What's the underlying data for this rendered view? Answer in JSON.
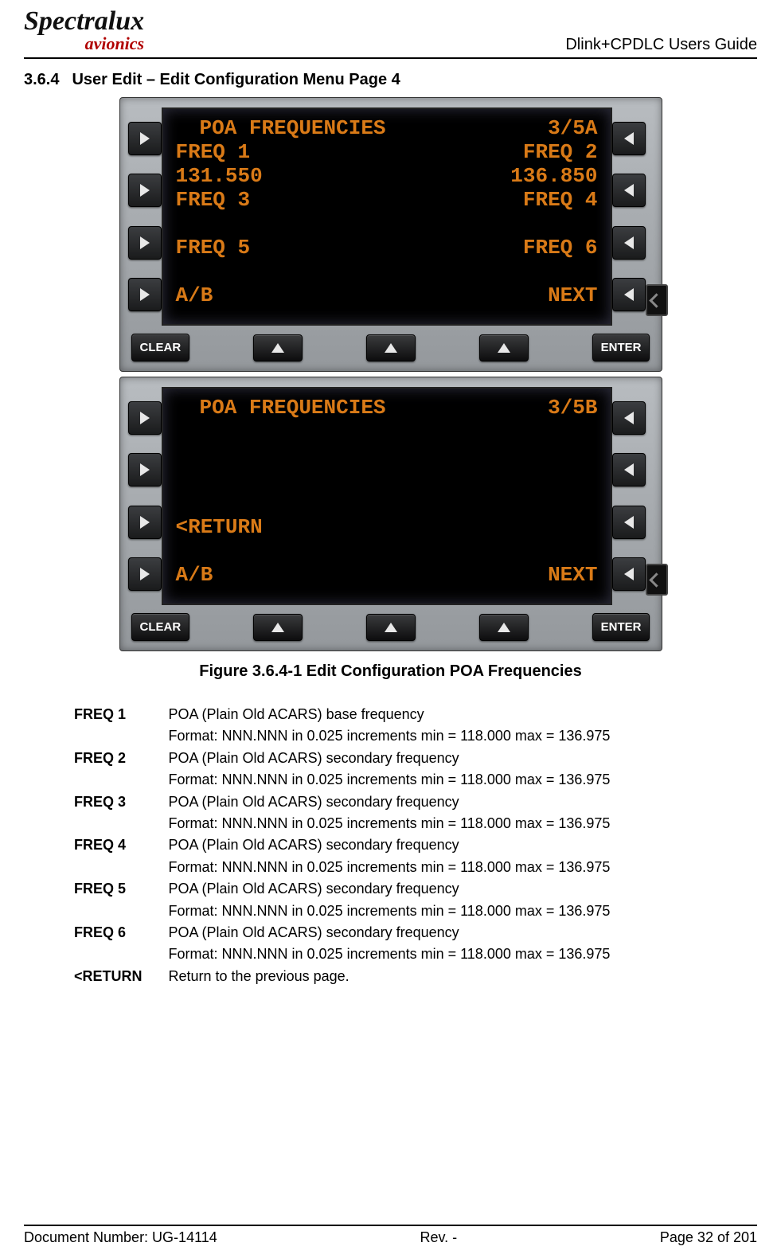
{
  "header": {
    "logo_top": "Spectralux",
    "logo_bottom": "avionics",
    "doc_title": "Dlink+CPDLC Users Guide"
  },
  "section": {
    "number": "3.6.4",
    "title": "User Edit – Edit Configuration Menu Page 4"
  },
  "device1": {
    "title_left": "POA FREQUENCIES",
    "title_right": "3/5A",
    "r1_left": "FREQ 1",
    "r1_right": "FREQ 2",
    "r2_left": "131.550",
    "r2_right": "136.850",
    "r3_left": "FREQ 3",
    "r3_right": "FREQ 4",
    "r4_left": "FREQ 5",
    "r4_right": "FREQ 6",
    "r5_left": "A/B",
    "r5_right": "NEXT",
    "clear": "CLEAR",
    "enter": "ENTER"
  },
  "device2": {
    "title_left": "POA FREQUENCIES",
    "title_right": "3/5B",
    "r4_left": "<RETURN",
    "r5_left": "A/B",
    "r5_right": "NEXT",
    "clear": "CLEAR",
    "enter": "ENTER"
  },
  "figure_caption": "Figure 3.6.4-1 Edit Configuration POA Frequencies",
  "definitions": [
    {
      "label": "FREQ 1",
      "line1": "POA (Plain Old ACARS) base frequency",
      "line2": "Format: NNN.NNN in 0.025 increments min = 118.000 max = 136.975"
    },
    {
      "label": "FREQ 2",
      "line1": "POA (Plain Old ACARS) secondary frequency",
      "line2": "Format: NNN.NNN in 0.025 increments min = 118.000 max = 136.975"
    },
    {
      "label": "FREQ 3",
      "line1": "POA (Plain Old ACARS) secondary frequency",
      "line2": "Format: NNN.NNN in 0.025 increments min = 118.000 max = 136.975"
    },
    {
      "label": "FREQ 4",
      "line1": "POA (Plain Old ACARS) secondary frequency",
      "line2": "Format: NNN.NNN in 0.025 increments min = 118.000 max = 136.975"
    },
    {
      "label": "FREQ 5",
      "line1": "POA (Plain Old ACARS) secondary frequency",
      "line2": "Format: NNN.NNN in 0.025 increments min = 118.000 max = 136.975"
    },
    {
      "label": "FREQ 6",
      "line1": "POA (Plain Old ACARS) secondary frequency",
      "line2": "Format: NNN.NNN in 0.025 increments min = 118.000 max = 136.975"
    },
    {
      "label": "<RETURN",
      "line1": "Return to the previous page.",
      "line2": ""
    }
  ],
  "footer": {
    "left": "Document Number:  UG-14114",
    "center": "Rev. -",
    "right": "Page 32 of 201"
  }
}
